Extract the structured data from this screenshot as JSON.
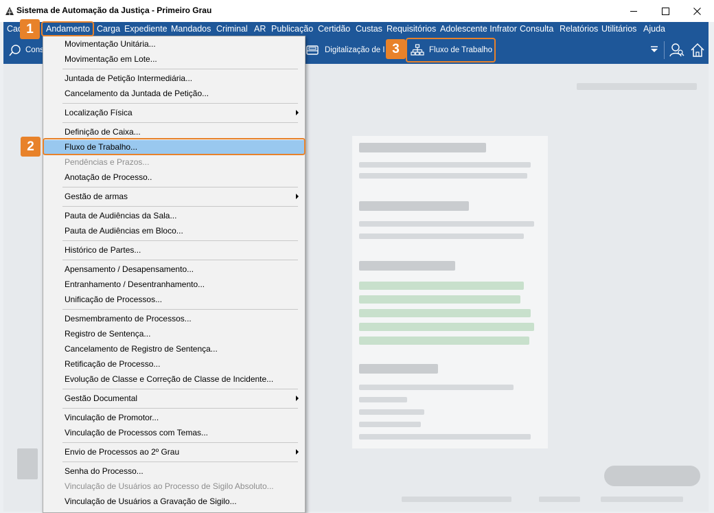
{
  "window": {
    "title": "Sistema de Automação da Justiça - Primeiro Grau",
    "minimize_icon": "minimize-icon",
    "maximize_icon": "maximize-icon",
    "close_icon": "close-icon"
  },
  "menubar": {
    "items": [
      {
        "label": "Cad"
      },
      {
        "label": "Andamento"
      },
      {
        "label": "Carga"
      },
      {
        "label": "Expediente"
      },
      {
        "label": "Mandados"
      },
      {
        "label": "Criminal"
      },
      {
        "label": "AR"
      },
      {
        "label": "Publicação"
      },
      {
        "label": "Certidão"
      },
      {
        "label": "Custas"
      },
      {
        "label": "Requisitórios"
      },
      {
        "label": "Adolescente Infrator"
      },
      {
        "label": "Consulta"
      },
      {
        "label": "Relatórios"
      },
      {
        "label": "Utilitários"
      },
      {
        "label": "Ajuda"
      }
    ]
  },
  "toolbar": {
    "consultar_label": "Cons",
    "digitalizacao_label": "Digitalização de I",
    "fluxo_label": "Fluxo de Trabalho"
  },
  "andamento_menu": {
    "items": [
      {
        "label": "Movimentação Unitária...",
        "enabled": true
      },
      {
        "label": "Movimentação em Lote...",
        "enabled": true
      },
      {
        "label": "Juntada de Petição Intermediária...",
        "enabled": true
      },
      {
        "label": "Cancelamento da Juntada de Petição...",
        "enabled": true
      },
      {
        "label": "Localização Física",
        "enabled": true,
        "submenu": true
      },
      {
        "label": "Definição de Caixa...",
        "enabled": true
      },
      {
        "label": "Fluxo de Trabalho...",
        "enabled": true,
        "highlighted": true
      },
      {
        "label": "Pendências e Prazos...",
        "enabled": false
      },
      {
        "label": "Anotação de Processo..",
        "enabled": true
      },
      {
        "label": "Gestão de armas",
        "enabled": true,
        "submenu": true
      },
      {
        "label": "Pauta de Audiências da Sala...",
        "enabled": true
      },
      {
        "label": "Pauta de Audiências em Bloco...",
        "enabled": true
      },
      {
        "label": "Histórico de Partes...",
        "enabled": true
      },
      {
        "label": "Apensamento / Desapensamento...",
        "enabled": true
      },
      {
        "label": "Entranhamento / Desentranhamento...",
        "enabled": true
      },
      {
        "label": "Unificação de Processos...",
        "enabled": true
      },
      {
        "label": "Desmembramento de Processos...",
        "enabled": true
      },
      {
        "label": "Registro de Sentença...",
        "enabled": true
      },
      {
        "label": "Cancelamento de Registro de Sentença...",
        "enabled": true
      },
      {
        "label": "Retificação de Processo...",
        "enabled": true
      },
      {
        "label": "Evolução de Classe e Correção de Classe de Incidente...",
        "enabled": true
      },
      {
        "label": "Gestão Documental",
        "enabled": true,
        "submenu": true
      },
      {
        "label": "Vinculação de Promotor...",
        "enabled": true
      },
      {
        "label": "Vinculação de Processos com Temas...",
        "enabled": true
      },
      {
        "label": "Envio de Processos ao 2º Grau",
        "enabled": true,
        "submenu": true
      },
      {
        "label": "Senha do Processo...",
        "enabled": true
      },
      {
        "label": "Vinculação de Usuários ao Processo de Sigilo Absoluto...",
        "enabled": false
      },
      {
        "label": "Vinculação de Usuários a Gravação de Sigilo...",
        "enabled": true
      }
    ]
  },
  "callouts": {
    "step1": "1",
    "step2": "2",
    "step3": "3",
    "color": "#e8822a"
  },
  "colors": {
    "menubar_bg": "#1e5799",
    "highlight_bg": "#99c8ef"
  }
}
